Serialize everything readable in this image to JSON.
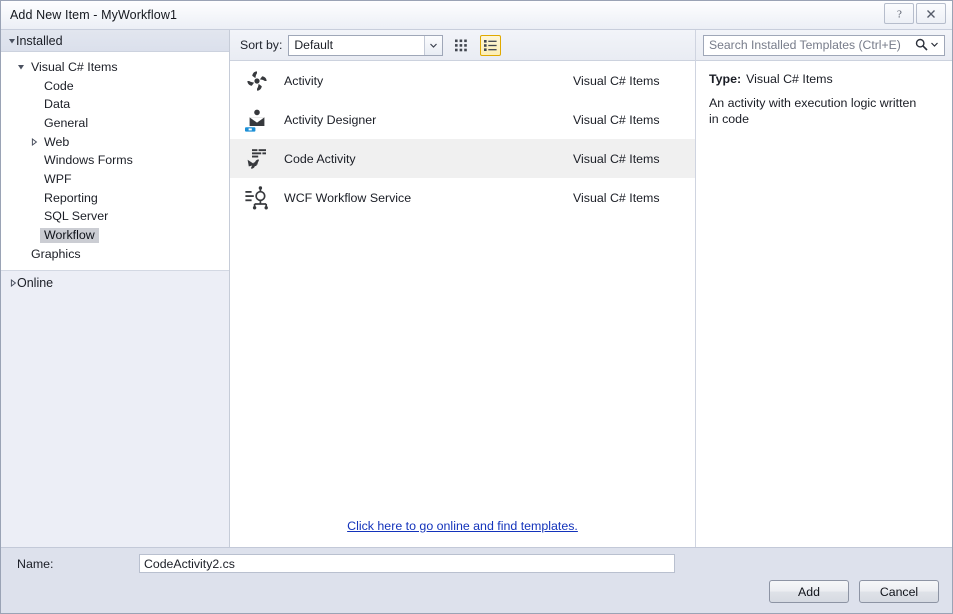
{
  "window": {
    "title": "Add New Item - MyWorkflow1",
    "help_button": "?",
    "close_button": "✕"
  },
  "sidebar": {
    "installed_header": "Installed",
    "online_header": "Online",
    "tree": [
      {
        "label": "Visual C# Items",
        "depth": 0,
        "expander": "expanded",
        "selected": false
      },
      {
        "label": "Code",
        "depth": 1,
        "expander": "none",
        "selected": false
      },
      {
        "label": "Data",
        "depth": 1,
        "expander": "none",
        "selected": false
      },
      {
        "label": "General",
        "depth": 1,
        "expander": "none",
        "selected": false
      },
      {
        "label": "Web",
        "depth": 1,
        "expander": "collapsed",
        "selected": false
      },
      {
        "label": "Windows Forms",
        "depth": 1,
        "expander": "none",
        "selected": false
      },
      {
        "label": "WPF",
        "depth": 1,
        "expander": "none",
        "selected": false
      },
      {
        "label": "Reporting",
        "depth": 1,
        "expander": "none",
        "selected": false
      },
      {
        "label": "SQL Server",
        "depth": 1,
        "expander": "none",
        "selected": false
      },
      {
        "label": "Workflow",
        "depth": 1,
        "expander": "none",
        "selected": true
      },
      {
        "label": "Graphics",
        "depth": 0,
        "expander": "none",
        "selected": false
      }
    ]
  },
  "toolbar": {
    "sort_by_label": "Sort by:",
    "sort_by_value": "Default",
    "grid_view_icon": "grid-view-icon",
    "list_view_icon": "list-view-icon",
    "active_view": "list"
  },
  "search": {
    "placeholder": "Search Installed Templates (Ctrl+E)",
    "value": "",
    "icon": "search-icon",
    "dropdown_icon": "chevron-down-icon"
  },
  "templates": {
    "items": [
      {
        "name": "Activity",
        "category": "Visual C# Items",
        "icon": "activity-icon",
        "selected": false
      },
      {
        "name": "Activity Designer",
        "category": "Visual C# Items",
        "icon": "activity-designer-icon",
        "selected": false
      },
      {
        "name": "Code Activity",
        "category": "Visual C# Items",
        "icon": "code-activity-icon",
        "selected": true
      },
      {
        "name": "WCF Workflow Service",
        "category": "Visual C# Items",
        "icon": "wcf-workflow-service-icon",
        "selected": false
      }
    ],
    "online_link": "Click here to go online and find templates."
  },
  "details": {
    "type_label": "Type:",
    "type_value": "Visual C# Items",
    "description": "An activity with execution logic written in code"
  },
  "footer": {
    "name_label": "Name:",
    "name_value": "CodeActivity2.cs",
    "add_label": "Add",
    "cancel_label": "Cancel"
  },
  "colors": {
    "accent_link": "#1333bb",
    "active_view_border": "#e0a900",
    "selection_gray": "#cbcdd3",
    "row_selection": "#f0f0f0",
    "panel_bg": "#eceef6",
    "footer_bg": "#dde1ec"
  }
}
